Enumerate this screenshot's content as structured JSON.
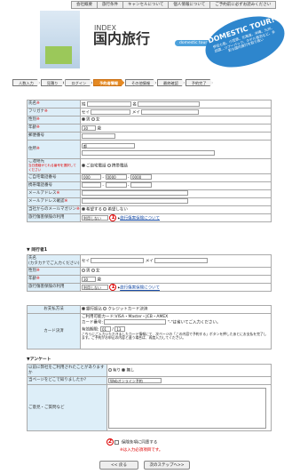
{
  "topnav": [
    "会社概要",
    "旅行条件",
    "キャンセルについて",
    "個人情報について",
    "ご予約前に必ずお読みください"
  ],
  "header": {
    "index": "INDEX",
    "title": "国内旅行",
    "domestic_label": "domestic tour",
    "badge_title": "DOMESTIC TOUR!",
    "badge_text": "伊豆七島、小笠原、北海道、沖縄、九州、四国…ツアーパック、ホテル宿泊など、多彩な国内旅行を取り扱い"
  },
  "steps": [
    "人数入力",
    "見積り",
    "ログイン",
    "予約者情報",
    "その他情報",
    "最終確認",
    "予約完了"
  ],
  "form": {
    "name": {
      "label": "氏名",
      "req": "※",
      "sei": "姓",
      "mei": "名"
    },
    "kana": {
      "label": "フリガナ",
      "req": "※",
      "sei": "セイ",
      "mei": "メイ"
    },
    "gender": {
      "label": "性別",
      "req": "※",
      "male": "男",
      "female": "女"
    },
    "age": {
      "label": "年齢",
      "req": "※",
      "value": "30",
      "unit": "歳"
    },
    "zip": {
      "label": "郵便番号"
    },
    "address": {
      "label": "住所",
      "req": "※",
      "value": "都"
    },
    "contact": {
      "label": "ご連絡先",
      "note": "当日連絡がとれる番号を選択してください",
      "home": "ご自宅電話",
      "mobile": "携帯電話"
    },
    "home_phone": {
      "label": "ご自宅電話番号",
      "v1": "000",
      "v2": "0000",
      "v3": "0000"
    },
    "mobile_phone": {
      "label": "携帯電話番号"
    },
    "email": {
      "label": "メールアドレス",
      "req": "※"
    },
    "email_confirm": {
      "label": "メールアドレス確認",
      "req": "※"
    },
    "magazine": {
      "label": "当社からのメールマガジン",
      "req": "※",
      "yes": "希望する",
      "no": "希望しない"
    },
    "insurance": {
      "label": "旅行傷害保険の利用",
      "value": "利用しない",
      "marker": "1",
      "link": "旅行傷害保険について"
    }
  },
  "companion": {
    "title": "▼ 同行者1",
    "name": {
      "label": "氏名\n(カタカナでご入力ください)",
      "sei": "セイ",
      "mei": "メイ"
    },
    "gender": {
      "label": "性別",
      "req": "※",
      "male": "男",
      "female": "女"
    },
    "age": {
      "label": "年齢",
      "req": "※",
      "value": "30",
      "unit": "歳"
    },
    "insurance": {
      "label": "旅行傷害保険の利用",
      "value": "利用しない",
      "marker": "1",
      "link": "旅行傷害保険について"
    }
  },
  "payment": {
    "label": "お支払方法",
    "bank": "銀行振込",
    "card": "クレジットカード決済",
    "card_label": "カード決済",
    "brands": "ご利用可能カード:VISA・Master・JCB・AMEX",
    "card_no": "カード番号:",
    "card_note": "\"-\"は省いてご入力ください。",
    "expiry": "有効期限:",
    "month": "01",
    "year": "13",
    "notice": "こちらにご入力いただきましたカード情報にて、次ページの「この内容で予約する」ボタンを押したあとにお支払を完了します。ご予約がお申込の内容と違う場合は、再度入力してください。"
  },
  "survey": {
    "title": "▼アンケート",
    "first": {
      "label": "以前に弊社をご利用されたことがありますか",
      "yes": "有り",
      "no": "無し"
    },
    "source": {
      "label": "当ページをどこで知りましたか?",
      "value": "Webオンライン予約"
    },
    "comment": {
      "label": "ご意見・ご質問など"
    }
  },
  "agree": {
    "marker": "2",
    "label": "保険条項に同意する",
    "note": "※は入力必須項目です。"
  },
  "buttons": {
    "back": "<< 戻る",
    "next": "次のステップへ>>"
  }
}
